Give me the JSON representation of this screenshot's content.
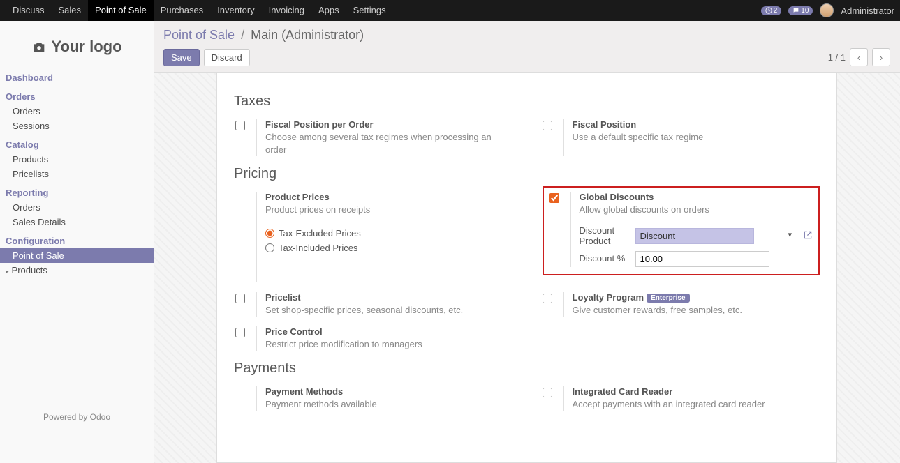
{
  "topnav": {
    "items": [
      "Discuss",
      "Sales",
      "Point of Sale",
      "Purchases",
      "Inventory",
      "Invoicing",
      "Apps",
      "Settings"
    ],
    "active": "Point of Sale",
    "badge1": "2",
    "badge2": "10",
    "user": "Administrator"
  },
  "logo": "Your logo",
  "sidebar": {
    "dashboard": "Dashboard",
    "orders": "Orders",
    "orders_orders": "Orders",
    "orders_sessions": "Sessions",
    "catalog": "Catalog",
    "catalog_products": "Products",
    "catalog_pricelists": "Pricelists",
    "reporting": "Reporting",
    "reporting_orders": "Orders",
    "reporting_sales_details": "Sales Details",
    "configuration": "Configuration",
    "config_pos": "Point of Sale",
    "config_products": "Products"
  },
  "powered": "Powered by Odoo",
  "breadcrumb": {
    "root": "Point of Sale",
    "current": "Main (Administrator)"
  },
  "buttons": {
    "save": "Save",
    "discard": "Discard"
  },
  "pager": {
    "text": "1 / 1"
  },
  "sections": {
    "taxes": "Taxes",
    "pricing": "Pricing",
    "payments": "Payments"
  },
  "settings": {
    "fiscal_per_order": {
      "title": "Fiscal Position per Order",
      "desc": "Choose among several tax regimes when processing an order"
    },
    "fiscal_position": {
      "title": "Fiscal Position",
      "desc": "Use a default specific tax regime"
    },
    "product_prices": {
      "title": "Product Prices",
      "desc": "Product prices on receipts",
      "opt1": "Tax-Excluded Prices",
      "opt2": "Tax-Included Prices"
    },
    "global_discounts": {
      "title": "Global Discounts",
      "desc": "Allow global discounts on orders",
      "discount_product_label": "Discount Product",
      "discount_product_value": "Discount",
      "discount_pct_label": "Discount %",
      "discount_pct_value": "10.00"
    },
    "pricelist": {
      "title": "Pricelist",
      "desc": "Set shop-specific prices, seasonal discounts, etc."
    },
    "loyalty": {
      "title": "Loyalty Program",
      "badge": "Enterprise",
      "desc": "Give customer rewards, free samples, etc."
    },
    "price_control": {
      "title": "Price Control",
      "desc": "Restrict price modification to managers"
    },
    "payment_methods": {
      "title": "Payment Methods",
      "desc": "Payment methods available"
    },
    "card_reader": {
      "title": "Integrated Card Reader",
      "desc": "Accept payments with an integrated card reader"
    }
  }
}
